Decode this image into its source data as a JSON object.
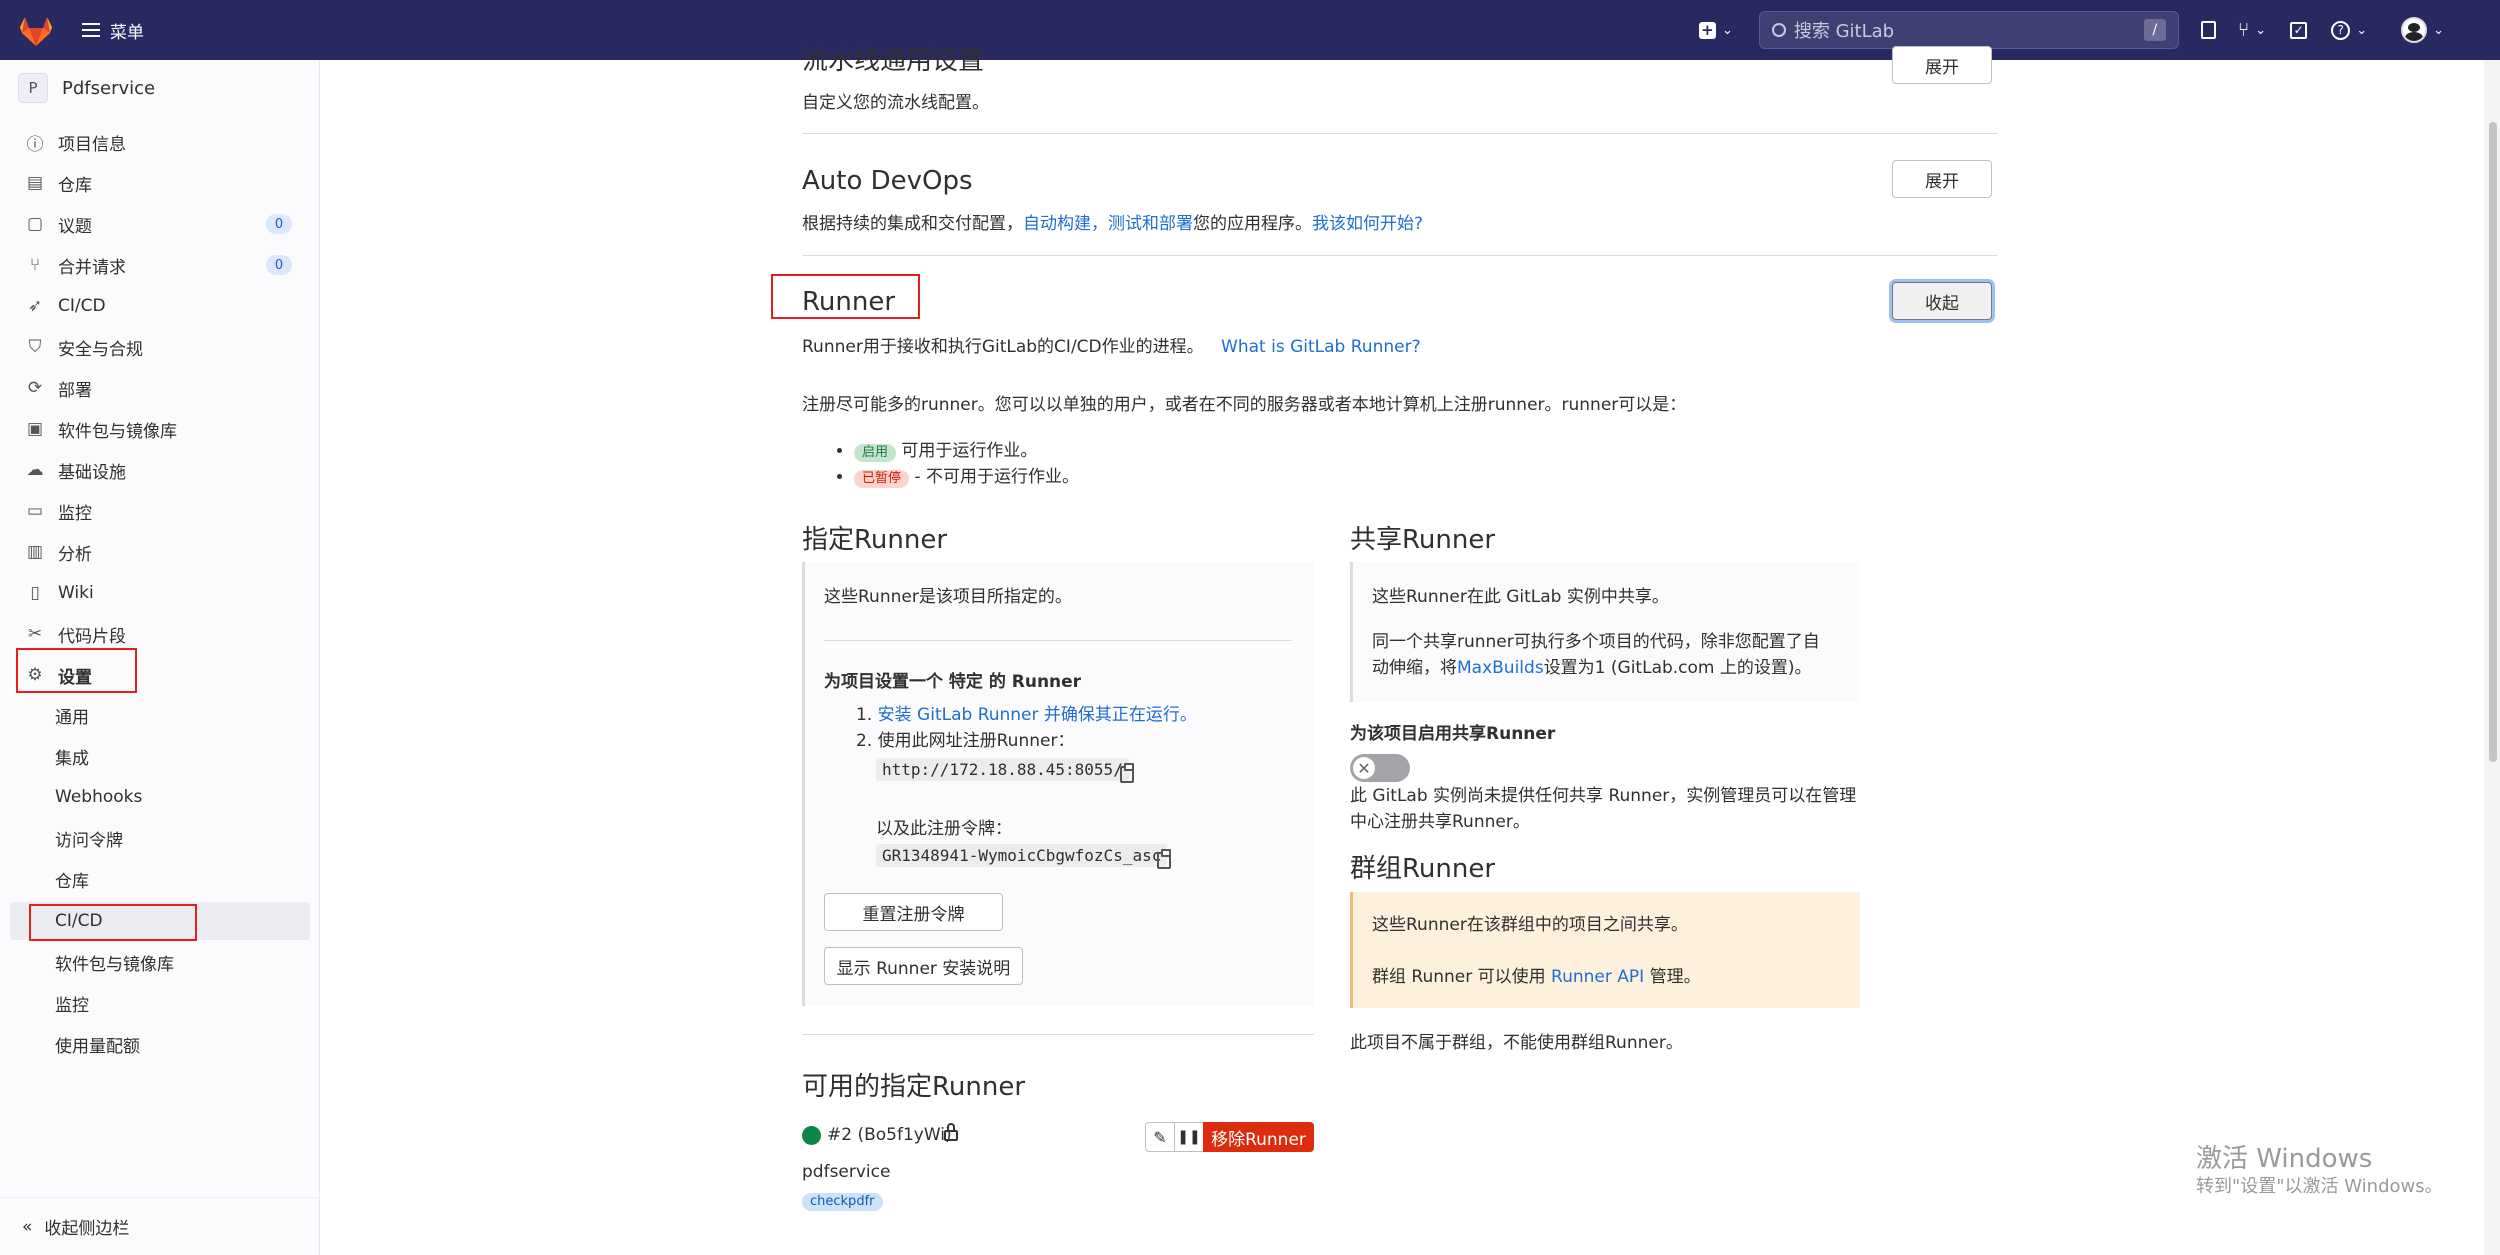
{
  "topbar": {
    "menu_label": "菜单",
    "search_placeholder": "搜索 GitLab",
    "search_shortcut": "/"
  },
  "sidebar": {
    "project_initial": "P",
    "project_name": "Pdfservice",
    "items": [
      {
        "label": "项目信息",
        "icon": "info-icon"
      },
      {
        "label": "仓库",
        "icon": "repository-icon"
      },
      {
        "label": "议题",
        "icon": "issues-icon",
        "badge": "0"
      },
      {
        "label": "合并请求",
        "icon": "merge-request-icon",
        "badge": "0"
      },
      {
        "label": "CI/CD",
        "icon": "rocket-icon"
      },
      {
        "label": "安全与合规",
        "icon": "shield-icon"
      },
      {
        "label": "部署",
        "icon": "deploy-icon"
      },
      {
        "label": "软件包与镜像库",
        "icon": "package-icon"
      },
      {
        "label": "基础设施",
        "icon": "cloud-icon"
      },
      {
        "label": "监控",
        "icon": "monitor-icon"
      },
      {
        "label": "分析",
        "icon": "chart-icon"
      },
      {
        "label": "Wiki",
        "icon": "book-icon"
      },
      {
        "label": "代码片段",
        "icon": "scissors-icon"
      },
      {
        "label": "设置",
        "icon": "gear-icon"
      }
    ],
    "settings_sub": [
      "通用",
      "集成",
      "Webhooks",
      "访问令牌",
      "仓库",
      "CI/CD",
      "软件包与镜像库",
      "监控",
      "使用量配额"
    ],
    "collapse_label": "收起侧边栏"
  },
  "main": {
    "pipeline_title": "流水线通用设置",
    "pipeline_btn": "展开",
    "pipeline_desc": "自定义您的流水线配置。",
    "autodevops_title": "Auto DevOps",
    "autodevops_btn": "展开",
    "autodevops_desc_1": "根据持续的集成和交付配置，",
    "autodevops_link_1": "自动构建，测试和部署",
    "autodevops_desc_2": "您的应用程序。",
    "autodevops_link_2": "我该如何开始?",
    "runner_title": "Runner",
    "runner_btn": "收起",
    "runner_desc": "Runner用于接收和执行GitLab的CI/CD作业的进程。",
    "runner_link": "What is GitLab Runner?",
    "register_desc": "注册尽可能多的runner。您可以以单独的用户，或者在不同的服务器或者本地计算机上注册runner。runner可以是：",
    "bullet_active_pill": "启用",
    "bullet_active_text": "可用于运行作业。",
    "bullet_paused_pill": "已暂停",
    "bullet_paused_text": "- 不可用于运行作业。",
    "specific": {
      "title": "指定Runner",
      "intro": "这些Runner是该项目所指定的。",
      "setup_title": "为项目设置一个 特定 的 Runner",
      "step1_prefix": "1.",
      "step1_link": "安装 GitLab Runner 并确保其正在运行。",
      "step2": "2. 使用此网址注册Runner：",
      "url": "http://172.18.88.45:8055/",
      "token_label": "以及此注册令牌：",
      "token": "GR1348941-WymoicCbgwfozCs_asc",
      "reset_btn": "重置注册令牌",
      "show_btn": "显示 Runner 安装说明"
    },
    "shared": {
      "title": "共享Runner",
      "intro": "这些Runner在此 GitLab 实例中共享。",
      "desc_1": "同一个共享runner可执行多个项目的代码，除非您配置了自",
      "desc_2a": "动伸缩，将",
      "desc_2_link": "MaxBuilds",
      "desc_2b": "设置为1 (GitLab.com 上的设置)。",
      "enable_label": "为该项目启用共享Runner",
      "note_1": "此 GitLab 实例尚未提供任何共享 Runner，实例管理员可以在管理",
      "note_2": "中心注册共享Runner。"
    },
    "group": {
      "title": "群组Runner",
      "intro": "这些Runner在该群组中的项目之间共享。",
      "desc_1": "群组 Runner 可以使用",
      "desc_link": "Runner API",
      "desc_2": "管理。",
      "note": "此项目不属于群组，不能使用群组Runner。"
    },
    "available": {
      "title": "可用的指定Runner",
      "runner_link": "#2 (Bo5f1yWi)",
      "project": "pdfservice",
      "tag": "checkpdfr",
      "remove_btn": "移除Runner"
    }
  },
  "watermark": {
    "line1": "激活 Windows",
    "line2": "转到\"设置\"以激活 Windows。"
  },
  "colors": {
    "topbar": "#292961",
    "link": "#1f6ed4",
    "danger": "#dd2b0e",
    "annotation": "#e41d1d"
  }
}
